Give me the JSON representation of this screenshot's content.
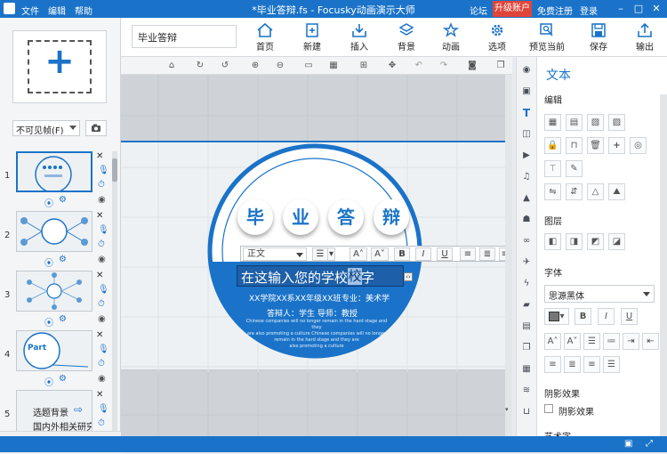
{
  "titlebar": {
    "menu": [
      "文件",
      "编辑",
      "帮助"
    ],
    "title": "*毕业答辩.fs - Focusky动画演示大师",
    "forum": "论坛",
    "upgrade": "升级账户",
    "register": "免费注册",
    "login": "登录"
  },
  "left_panel": {
    "visibility": "不可见帧(F)",
    "slides": [
      {
        "num": "1"
      },
      {
        "num": "2"
      },
      {
        "num": "3"
      },
      {
        "num": "4"
      },
      {
        "num": "5",
        "text1": "选题背景",
        "text2": "国内外相关研究"
      }
    ],
    "slide4_text": "Part"
  },
  "ribbon": {
    "doc_name": "毕业答辩",
    "buttons": [
      "首页",
      "新建",
      "插入",
      "背景",
      "动画",
      "选项",
      "预览当前",
      "保存",
      "输出"
    ]
  },
  "slide": {
    "title_chars": [
      "毕",
      "业",
      "答",
      "辩"
    ],
    "name_text": "在这输入您的学校名字",
    "name_selected": "校",
    "line1": "XX学院XX系XX年级XX班",
    "major": "专业：美术学",
    "line2": "答辩人：学生   导师：教授",
    "body": [
      "Chinese companies will no longer remain in the hard stage and they",
      "are also promoting a culture Chinese companies will no longer",
      "remain in the hard stage and they are",
      "also promoting a culture"
    ]
  },
  "text_toolbar": {
    "style": "正文",
    "bold": "B",
    "italic": "I",
    "underline": "U"
  },
  "props": {
    "title": "文本",
    "edit": "编辑",
    "layer": "图层",
    "font": "字体",
    "font_name": "思源黑体",
    "bold": "B",
    "italic": "I",
    "underline": "U",
    "shadow": "阴影效果",
    "shadow_checkbox": "阴影效果",
    "art": "艺术字"
  },
  "colors": {
    "brand": "#1a73c8",
    "upgrade": "#e0453a"
  }
}
